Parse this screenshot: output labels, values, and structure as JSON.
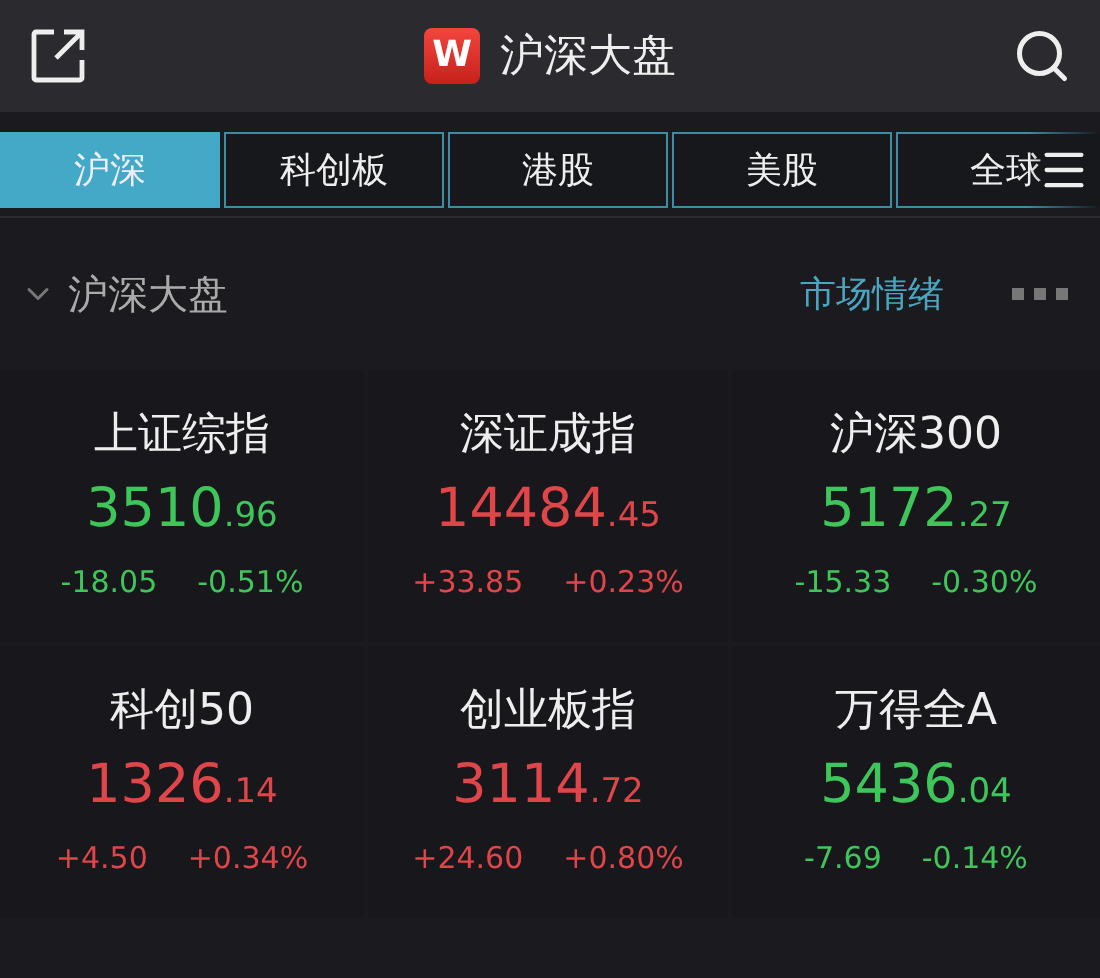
{
  "header": {
    "logo": "W",
    "title": "沪深大盘"
  },
  "tabs": [
    {
      "label": "沪深",
      "selected": true
    },
    {
      "label": "科创板",
      "selected": false
    },
    {
      "label": "港股",
      "selected": false
    },
    {
      "label": "美股",
      "selected": false
    },
    {
      "label": "全球",
      "selected": false
    }
  ],
  "section": {
    "title": "沪深大盘",
    "expanded": true,
    "link": "市场情绪"
  },
  "indices": [
    {
      "name": "上证综指",
      "value_int": "3510",
      "value_dec": ".96",
      "change": "-18.05",
      "percent": "-0.51%",
      "color": "#3fc65a"
    },
    {
      "name": "深证成指",
      "value_int": "14484",
      "value_dec": ".45",
      "change": "+33.85",
      "percent": "+0.23%",
      "color": "#e0454a"
    },
    {
      "name": "沪深300",
      "value_int": "5172",
      "value_dec": ".27",
      "change": "-15.33",
      "percent": "-0.30%",
      "color": "#3fc65a"
    },
    {
      "name": "科创50",
      "value_int": "1326",
      "value_dec": ".14",
      "change": "+4.50",
      "percent": "+0.34%",
      "color": "#e0454a"
    },
    {
      "name": "创业板指",
      "value_int": "3114",
      "value_dec": ".72",
      "change": "+24.60",
      "percent": "+0.80%",
      "color": "#e0454a"
    },
    {
      "name": "万得全A",
      "value_int": "5436",
      "value_dec": ".04",
      "change": "-7.69",
      "percent": "-0.14%",
      "color": "#3fc65a"
    }
  ]
}
